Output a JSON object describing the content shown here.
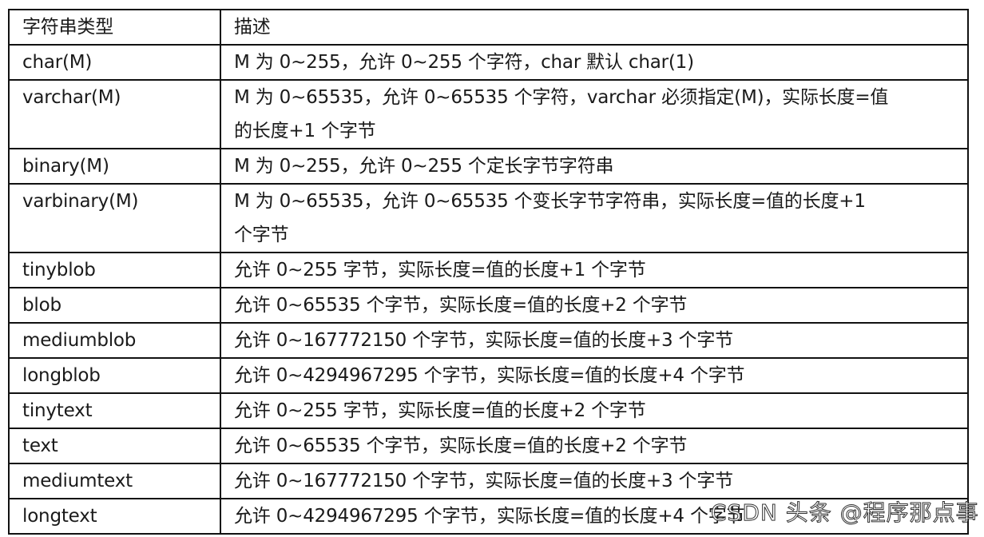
{
  "table": {
    "headers": [
      "字符串类型",
      "描述"
    ],
    "rows": [
      {
        "type": "char(M)",
        "desc": [
          "M 为 0~255，允许 0~255 个字符，char 默认 char(1)"
        ]
      },
      {
        "type": "varchar(M)",
        "desc": [
          "M 为 0~65535，允许 0~65535 个字符，varchar 必须指定(M)，实际长度=值",
          "的长度+1 个字节"
        ]
      },
      {
        "type": "binary(M)",
        "desc": [
          "M 为 0~255，允许 0~255 个定长字节字符串"
        ]
      },
      {
        "type": "varbinary(M)",
        "desc": [
          "M 为 0~65535，允许 0~65535 个变长字节字符串，实际长度=值的长度+1",
          "个字节"
        ]
      },
      {
        "type": "tinyblob",
        "desc": [
          "允许 0~255 字节，实际长度=值的长度+1 个字节"
        ]
      },
      {
        "type": "blob",
        "desc": [
          "允许 0~65535 个字节，实际长度=值的长度+2 个字节"
        ]
      },
      {
        "type": "mediumblob",
        "desc": [
          "允许 0~167772150 个字节，实际长度=值的长度+3 个字节"
        ]
      },
      {
        "type": "longblob",
        "desc": [
          "允许 0~4294967295 个字节，实际长度=值的长度+4 个字节"
        ]
      },
      {
        "type": "tinytext",
        "desc": [
          "允许 0~255 字节，实际长度=值的长度+2 个字节"
        ]
      },
      {
        "type": "text",
        "desc": [
          "允许 0~65535 个字节，实际长度=值的长度+2 个字节"
        ]
      },
      {
        "type": "mediumtext",
        "desc": [
          "允许 0~167772150 个字节，实际长度=值的长度+3 个字节"
        ]
      },
      {
        "type": "longtext",
        "desc": [
          "允许 0~4294967295 个字节，实际长度=值的长度+4 个字节"
        ]
      }
    ]
  },
  "watermark": "CSDN 头条 @程序那点事"
}
